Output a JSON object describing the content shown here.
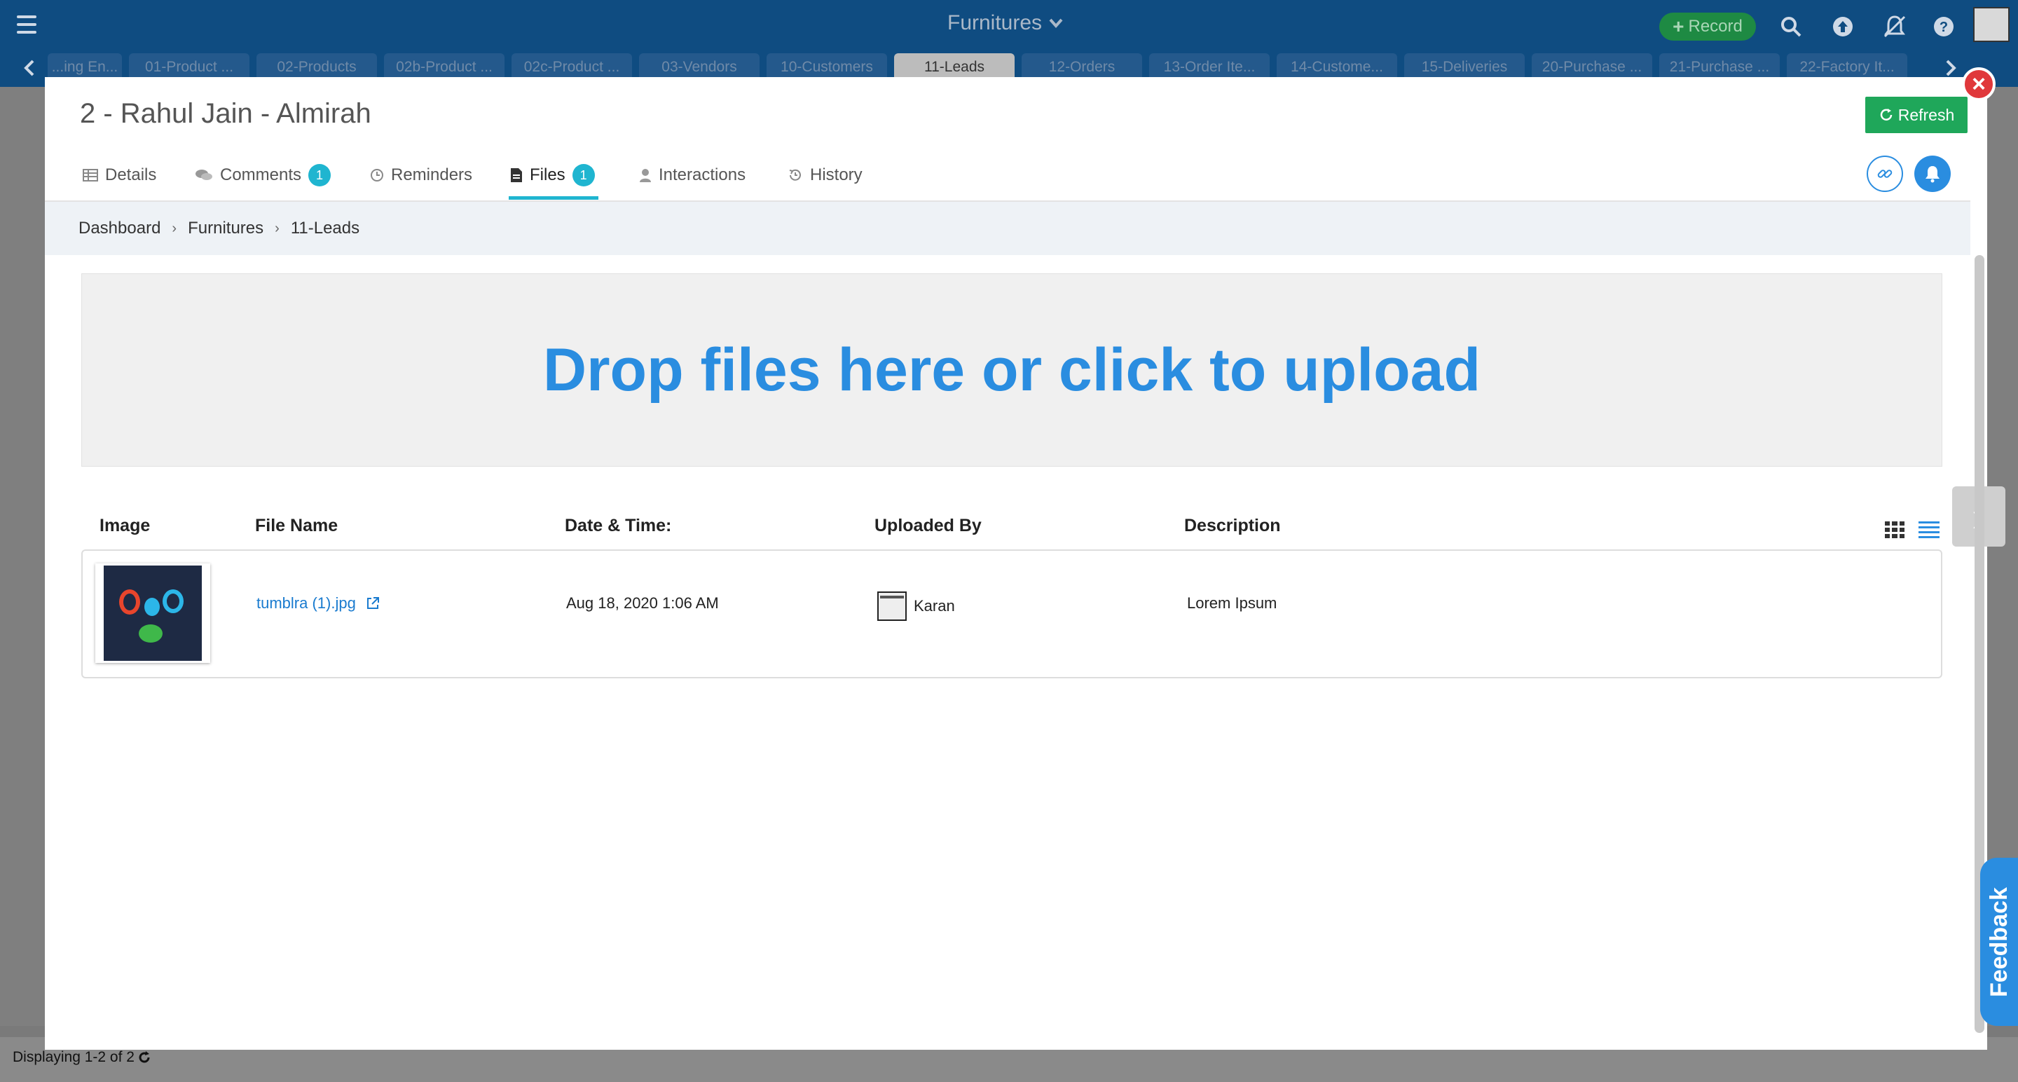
{
  "app": {
    "title": "Furnitures",
    "record_label": "Record"
  },
  "sheet_tabs": [
    {
      "label": "...ing En..."
    },
    {
      "label": "01-Product ..."
    },
    {
      "label": "02-Products"
    },
    {
      "label": "02b-Product ..."
    },
    {
      "label": "02c-Product ..."
    },
    {
      "label": "03-Vendors"
    },
    {
      "label": "10-Customers"
    },
    {
      "label": "11-Leads",
      "active": true
    },
    {
      "label": "12-Orders"
    },
    {
      "label": "13-Order Ite..."
    },
    {
      "label": "14-Custome..."
    },
    {
      "label": "15-Deliveries"
    },
    {
      "label": "20-Purchase ..."
    },
    {
      "label": "21-Purchase ..."
    },
    {
      "label": "22-Factory It..."
    }
  ],
  "record": {
    "title": "2 - Rahul Jain - Almirah",
    "refresh_label": "Refresh"
  },
  "tabs": [
    {
      "label": "Details",
      "icon": "table-icon"
    },
    {
      "label": "Comments",
      "icon": "comments-icon",
      "badge": "1"
    },
    {
      "label": "Reminders",
      "icon": "clock-icon"
    },
    {
      "label": "Files",
      "icon": "file-icon",
      "badge": "1",
      "active": true
    },
    {
      "label": "Interactions",
      "icon": "user-icon"
    },
    {
      "label": "History",
      "icon": "history-icon"
    }
  ],
  "breadcrumb": [
    "Dashboard",
    "Furnitures",
    "11-Leads"
  ],
  "dropzone": {
    "text": "Drop files here or click to upload"
  },
  "files_table": {
    "columns": [
      "Image",
      "File Name",
      "Date & Time:",
      "Uploaded By",
      "Description"
    ],
    "rows": [
      {
        "file_name": "tumblra (1).jpg",
        "date_time": "Aug 18, 2020 1:06 AM",
        "uploaded_by": "Karan",
        "description": "Lorem Ipsum"
      }
    ]
  },
  "footer": {
    "displaying": "Displaying 1-2 of 2"
  },
  "feedback_label": "Feedback",
  "colors": {
    "header_bg": "#0f4c81",
    "accent_blue": "#2a8de0",
    "refresh_green": "#1fa75a",
    "badge_teal": "#1fb5d0",
    "close_red": "#e0383b"
  }
}
